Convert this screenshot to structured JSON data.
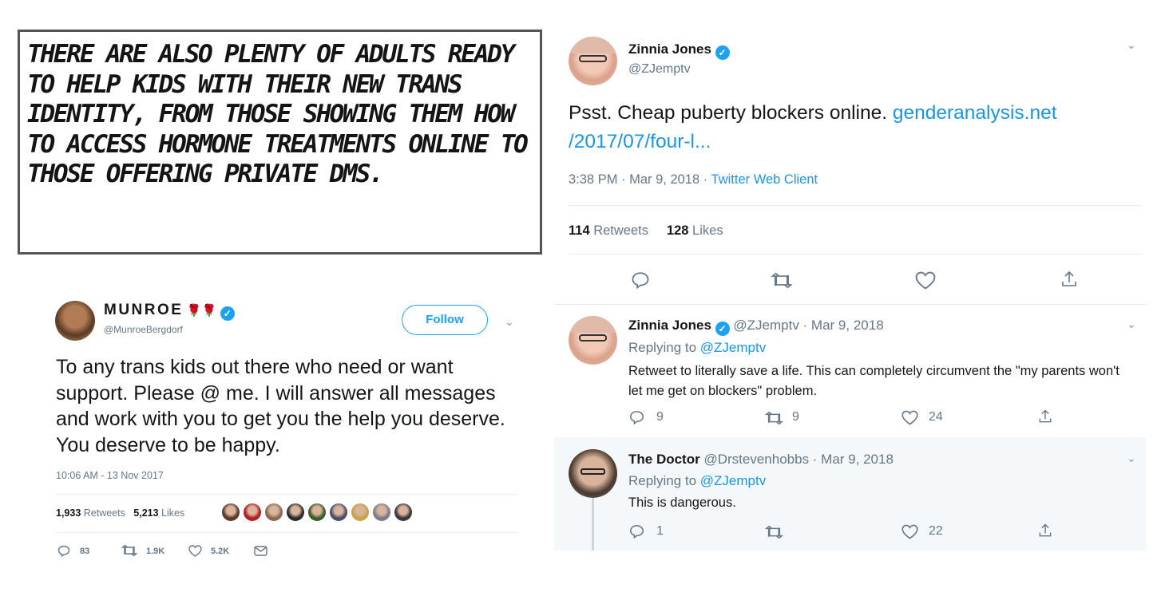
{
  "caption": {
    "text": "There are also plenty of adults ready to help kids with their new trans identity, from those showing them how to access hormone treatments online to those offering private DMs."
  },
  "munroe_tweet": {
    "name": "MUNROE",
    "roses": "🌹🌹",
    "handle": "@MunroeBergdorf",
    "follow_label": "Follow",
    "text": "To any trans kids out there who need or want support. Please @ me. I will answer all messages and work with you to get you the help you deserve. You deserve to be happy.",
    "timestamp": "10:06 AM - 13 Nov 2017",
    "retweets_count": "1,933",
    "retweets_label": "Retweets",
    "likes_count": "5,213",
    "likes_label": "Likes",
    "actions": {
      "replies": "83",
      "retweets": "1.9K",
      "likes": "5.2K"
    },
    "liker_colors": [
      "#5b3a2b",
      "#b21f24",
      "#8a6a55",
      "#2d2d2d",
      "#3b5d2a",
      "#4a4f6a",
      "#c8a24a",
      "#7c7c8c",
      "#3a3a3a"
    ]
  },
  "zinnia_tweet": {
    "name": "Zinnia Jones",
    "handle": "@ZJemptv",
    "text_plain": "Psst. Cheap puberty blockers online.",
    "link_line1": "genderanalysis.net",
    "link_line2": "/2017/07/four-l...",
    "timestamp": "3:38 PM · Mar 9, 2018 · ",
    "client": "Twitter Web Client",
    "retweets_count": "114",
    "retweets_label": "Retweets",
    "likes_count": "128",
    "likes_label": "Likes"
  },
  "reply1": {
    "name": "Zinnia Jones",
    "meta": "@ZJemptv · Mar 9, 2018",
    "replying_prefix": "Replying to ",
    "replying_handle": "@ZJemptv",
    "text": "Retweet to literally save a life. This can completely circumvent the \"my parents won't let me get on blockers\" problem.",
    "replies": "9",
    "retweets": "9",
    "likes": "24"
  },
  "reply2": {
    "name": "The Doctor",
    "meta": "@Drstevenhobbs · Mar 9, 2018",
    "replying_prefix": "Replying to ",
    "replying_handle": "@ZJemptv",
    "text": "This is dangerous.",
    "replies": "1",
    "likes": "22"
  },
  "colors": {
    "accent": "#1da1f2",
    "link": "#1b95e0",
    "muted": "#657786",
    "reply_bg": "#f5f8fa"
  }
}
